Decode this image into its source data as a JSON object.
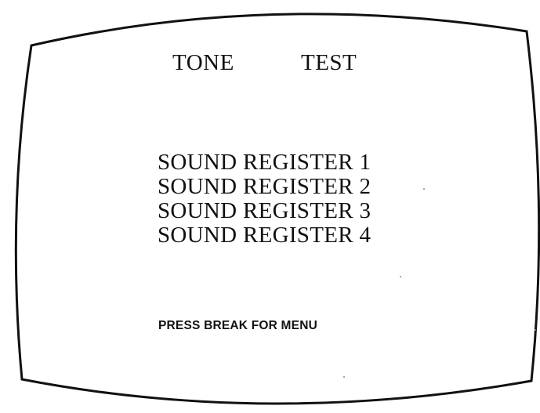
{
  "screen": {
    "title_word1": "TONE",
    "title_word2": "TEST",
    "registers": [
      "SOUND REGISTER 1",
      "SOUND REGISTER 2",
      "SOUND REGISTER 3",
      "SOUND REGISTER 4"
    ],
    "prompt_before": "PRESS",
    "prompt_key": "BREAK",
    "prompt_after": "FOR MENU"
  }
}
